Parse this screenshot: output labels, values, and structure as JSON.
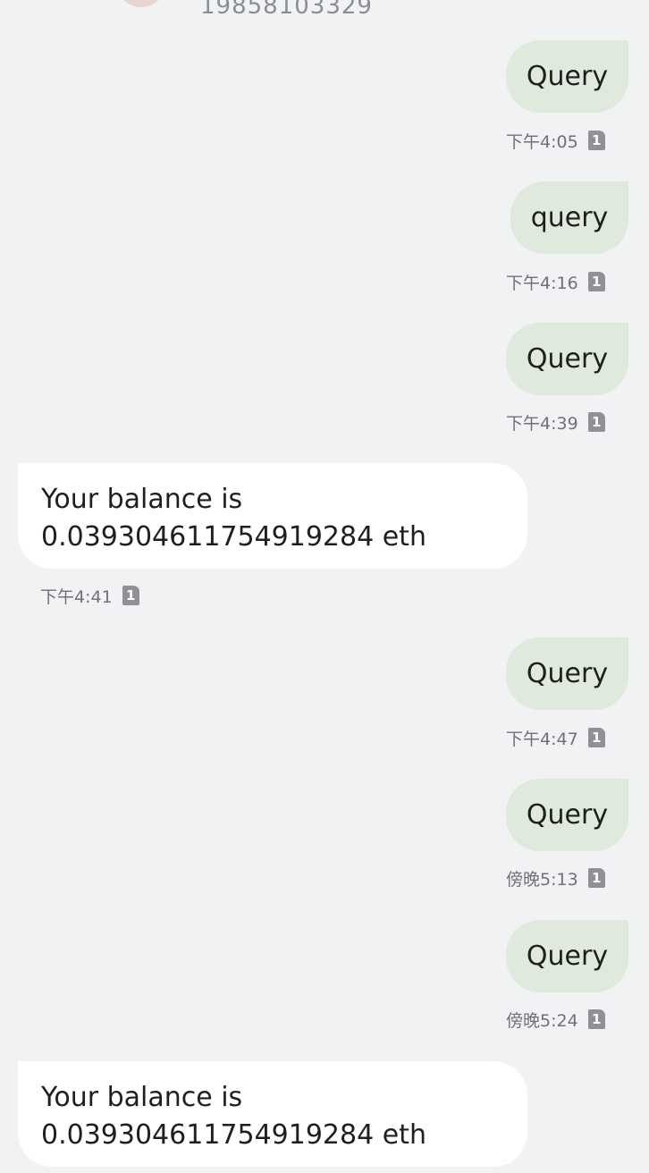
{
  "header": {
    "phone_number": "19858103329"
  },
  "messages": [
    {
      "direction": "out",
      "text": "Query",
      "time": "下午4:05",
      "sim": "1"
    },
    {
      "direction": "out",
      "text": "query",
      "time": "下午4:16",
      "sim": "1"
    },
    {
      "direction": "out",
      "text": "Query",
      "time": "下午4:39",
      "sim": "1"
    },
    {
      "direction": "in",
      "line1": "Your balance is",
      "line2": "0.039304611754919284 eth",
      "time": "下午4:41",
      "sim": "1"
    },
    {
      "direction": "out",
      "text": "Query",
      "time": "下午4:47",
      "sim": "1"
    },
    {
      "direction": "out",
      "text": "Query",
      "time": "傍晚5:13",
      "sim": "1"
    },
    {
      "direction": "out",
      "text": "Query",
      "time": "傍晚5:24",
      "sim": "1"
    },
    {
      "direction": "in",
      "line1": "Your balance is",
      "line2": "0.039304611754919284 eth"
    }
  ],
  "colors": {
    "background": "#f1f2f4",
    "outgoing_bubble": "#dfe9dc",
    "incoming_bubble": "#ffffff",
    "timestamp_text": "#6f7176"
  },
  "icons": {
    "sim_indicator": "sim-card-1-icon"
  }
}
